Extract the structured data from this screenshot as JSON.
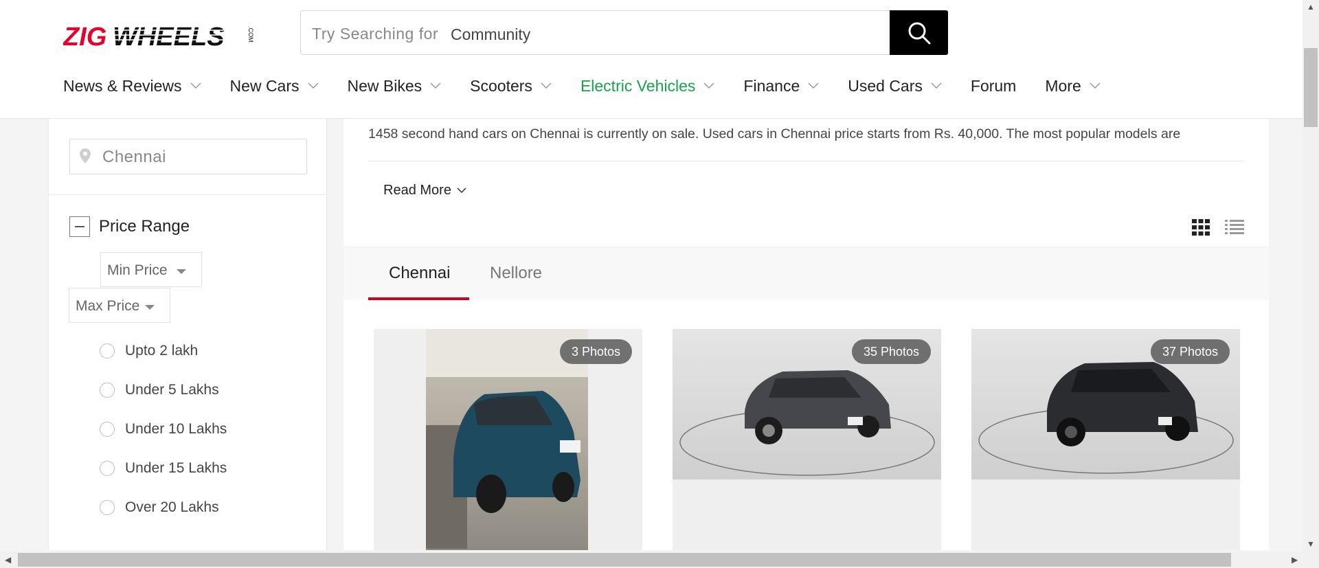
{
  "header": {
    "logo_text": "ZIGWHEELS.COM",
    "search_placeholder": "Try Searching for",
    "search_term": "Community"
  },
  "nav": [
    {
      "label": "News & Reviews",
      "dropdown": true
    },
    {
      "label": "New Cars",
      "dropdown": true
    },
    {
      "label": "New Bikes",
      "dropdown": true
    },
    {
      "label": "Scooters",
      "dropdown": true
    },
    {
      "label": "Electric Vehicles",
      "dropdown": true,
      "active": true
    },
    {
      "label": "Finance",
      "dropdown": true
    },
    {
      "label": "Used Cars",
      "dropdown": true
    },
    {
      "label": "Forum",
      "dropdown": false
    },
    {
      "label": "More",
      "dropdown": true
    }
  ],
  "sidebar": {
    "location": "Chennai",
    "filter_title": "Price Range",
    "min_price": "Min Price",
    "max_price": "Max Price",
    "options": [
      "Upto 2 lakh",
      "Under 5 Lakhs",
      "Under 10 Lakhs",
      "Under 15 Lakhs",
      "Over 20 Lakhs"
    ]
  },
  "main": {
    "intro": "1458 second hand cars on Chennai is currently on sale. Used cars in Chennai price starts from Rs. 40,000. The most popular models are",
    "read_more": "Read More",
    "tabs": [
      {
        "label": "Chennai",
        "active": true
      },
      {
        "label": "Nellore",
        "active": false
      }
    ],
    "cards": [
      {
        "photos": "3 Photos",
        "car_color": "#1d4a5e"
      },
      {
        "photos": "35 Photos",
        "car_color": "#45474d"
      },
      {
        "photos": "37 Photos",
        "car_color": "#2b2c30"
      }
    ]
  },
  "colors": {
    "accent_green": "#16a34a",
    "tab_red": "#d0021b",
    "logo_red": "#e4032e"
  }
}
